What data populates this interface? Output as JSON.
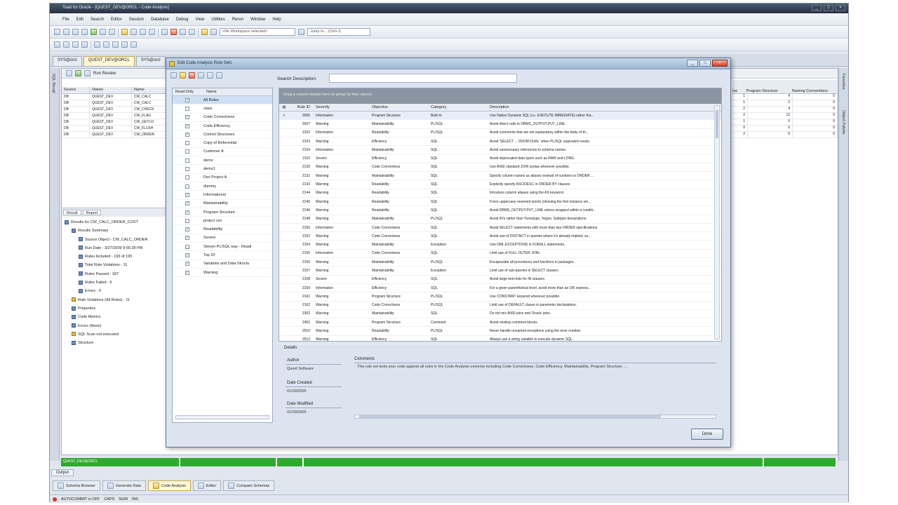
{
  "window": {
    "title": "Toad for Oracle - [QUEST_DEV@ORCL - Code Analysis]",
    "controls": [
      "_",
      "□",
      "×"
    ]
  },
  "menu": [
    "File",
    "Edit",
    "Search",
    "Editor",
    "Session",
    "Database",
    "Debug",
    "View",
    "Utilities",
    "Rerun",
    "Window",
    "Help"
  ],
  "toolbar": {
    "schema_combo": "<No Workspace selected>",
    "jump_combo": "Jump to... (Ctrl+J)"
  },
  "dock_tabs": [
    "SYS@orcl",
    "QUEST_DEV@ORCL",
    "SYS@orcl"
  ],
  "left_strip_label": "SQL Recall",
  "right_strip_labels": [
    "Favorites",
    "Object Palette"
  ],
  "workspace": {
    "run_review_label": "Run Review",
    "grid_headers": [
      "Source",
      "Owner",
      "Name"
    ],
    "grid_rows": [
      [
        "DB",
        "QUEST_DEV",
        "CW_CALC"
      ],
      [
        "DB",
        "QUEST_DEV",
        "CW_CALC"
      ],
      [
        "DB",
        "QUEST_DEV",
        "CW_CHECK"
      ],
      [
        "DB",
        "QUEST_DEV",
        "CW_FLAG"
      ],
      [
        "DB",
        "QUEST_DEV",
        "CW_GETLO"
      ],
      [
        "DB",
        "QUEST_DEV",
        "CW_FLUSH"
      ],
      [
        "DB",
        "QUEST_DEV",
        "CW_ORDER"
      ]
    ],
    "right_headers": [
      "Ive",
      "Program Structure",
      "Naming Conventions"
    ],
    "right_rows": [
      [
        "1",
        "4",
        "0"
      ],
      [
        "1",
        "2",
        "0"
      ],
      [
        "2",
        "4",
        "0"
      ],
      [
        "2",
        "12",
        "0"
      ],
      [
        "1",
        "0",
        "0"
      ],
      [
        "0",
        "0",
        "0"
      ],
      [
        "2",
        "0",
        "0"
      ]
    ],
    "lower_tabs": [
      "Result",
      "Report"
    ],
    "tree": [
      "Results for CW_CALC_ORDER_COST",
      "Results Summary",
      "Source Object - CW_CALC_ORDER",
      "Run Date - 3/27/2009 9:55:28 PM",
      "Rules Included - 193 of 195",
      "Total Rule Violations - 11",
      "Rules Passed - 187",
      "Rules Failed - 6",
      "Errors - 0",
      "Rule Violations (All Rules) - 11",
      "Properties",
      "Code Metrics",
      "Errors (None)",
      "SQL Scan not executed",
      "Structure"
    ],
    "bottom_row_status": "DB DUCHSS"
  },
  "status_strip": [
    "QUEST_DEV@ORCL",
    "",
    "",
    "",
    ""
  ],
  "output_label": "Output",
  "bottom_tabs": [
    "Schema Browser",
    "Generate Data",
    "Code Analysis",
    "Editor",
    "Compare Schemas"
  ],
  "statusbar": [
    "AUTOCOMMIT is OFF",
    "CAPS",
    "NUM",
    "INS"
  ],
  "dialog": {
    "title": "Edit Code Analysis Rule Sets",
    "search_label": "Search Description:",
    "left_headers": [
      "Read Only",
      "Name"
    ],
    "rule_sets": [
      {
        "name": "All Rules",
        "ro": true
      },
      {
        "name": "class",
        "ro": false
      },
      {
        "name": "Code Correctness",
        "ro": true
      },
      {
        "name": "Code Efficiency",
        "ro": true
      },
      {
        "name": "Control Structures",
        "ro": true
      },
      {
        "name": "Copy of Referential",
        "ro": false
      },
      {
        "name": "Customer A",
        "ro": false
      },
      {
        "name": "demo",
        "ro": false
      },
      {
        "name": "demo1",
        "ro": false
      },
      {
        "name": "Dev Project A",
        "ro": false
      },
      {
        "name": "dummy",
        "ro": false
      },
      {
        "name": "Informational",
        "ro": true
      },
      {
        "name": "Maintainability",
        "ro": true
      },
      {
        "name": "Program Structure",
        "ro": true
      },
      {
        "name": "project xxx",
        "ro": false
      },
      {
        "name": "Readability",
        "ro": true
      },
      {
        "name": "Severe",
        "ro": true
      },
      {
        "name": "Steven PL/SQL way - Readi",
        "ro": false
      },
      {
        "name": "Top 20",
        "ro": true
      },
      {
        "name": "Variables and Data Structu",
        "ro": true
      },
      {
        "name": "Warning",
        "ro": true
      }
    ],
    "group_hint": "Drag a column header here to group by that column",
    "grid_headers": [
      "Rule ID",
      "Severity",
      "Objective",
      "Category",
      "Description"
    ],
    "rules": [
      [
        "2006",
        "Information",
        "Program Structure",
        "Built-In",
        "Use Native Dynamic SQL (i.e. EXECUTE IMMEDIATE) rather tha..."
      ],
      [
        "2007",
        "Warning",
        "Maintainability",
        "PL/SQL",
        "Avoid direct calls to DBMS_OUTPUT.PUT_LINE."
      ],
      [
        "2102",
        "Information",
        "Readability",
        "PL/SQL",
        "Avoid comments that are not explanatory within the body of th..."
      ],
      [
        "2103",
        "Warning",
        "Efficiency",
        "SQL",
        "Avoid 'SELECT ... FROM DUAL' when PL/SQL equivalent exists."
      ],
      [
        "2104",
        "Information",
        "Maintainability",
        "SQL",
        "Avoid unnecessary references to schema names."
      ],
      [
        "2110",
        "Severe",
        "Efficiency",
        "SQL",
        "Avoid deprecated data types such as RAW and LONG."
      ],
      [
        "2130",
        "Warning",
        "Code Correctness",
        "SQL",
        "Use ANSI standard JOIN syntax wherever possible."
      ],
      [
        "2132",
        "Warning",
        "Maintainability",
        "SQL",
        "Specify column names as aliases instead of numbers in ORDER ..."
      ],
      [
        "2133",
        "Warning",
        "Readability",
        "SQL",
        "Explicitly specify ASC/DESC in ORDER BY clauses."
      ],
      [
        "2144",
        "Warning",
        "Readability",
        "SQL",
        "Introduce column aliases using the AS keyword."
      ],
      [
        "2145",
        "Warning",
        "Readability",
        "SQL",
        "Force uppercase reserved words (showing the first instance wri..."
      ],
      [
        "2146",
        "Warning",
        "Readability",
        "SQL",
        "Avoid DBMS_OUTPUT.PUT_LINE unless wrapped within a conditi..."
      ],
      [
        "2148",
        "Warning",
        "Maintainability",
        "PL/SQL",
        "Avoid IN's rather than %rowtype, %type, Subtype declarations."
      ],
      [
        "2150",
        "Information",
        "Code Correctness",
        "SQL",
        "Avoid SELECT statements with more than two ORDER specifications."
      ],
      [
        "2152",
        "Warning",
        "Code Correctness",
        "SQL",
        "Avoid use of DISTINCT in queries where it's already implied, su..."
      ],
      [
        "2154",
        "Warning",
        "Maintainability",
        "Exception",
        "Use DML EXCEPTIONS in FORALL statements."
      ],
      [
        "2155",
        "Information",
        "Code Correctness",
        "SQL",
        "Limit use of FULL OUTER JOIN."
      ],
      [
        "2156",
        "Warning",
        "Maintainability",
        "PL/SQL",
        "Encapsulate all procedures and functions in packages."
      ],
      [
        "2157",
        "Warning",
        "Maintainability",
        "Exception",
        "Limit use of sub-queries in SELECT clauses."
      ],
      [
        "2158",
        "Severe",
        "Efficiency",
        "SQL",
        "Avoid large item lists for IN clauses."
      ],
      [
        "2159",
        "Information",
        "Efficiency",
        "SQL",
        "For a given parenthetical level, avoid more than an OR express..."
      ],
      [
        "2161",
        "Warning",
        "Program Structure",
        "PL/SQL",
        "Use CONSTANT keyword wherever possible."
      ],
      [
        "2162",
        "Warning",
        "Code Correctness",
        "PL/SQL",
        "Limit use of DEFAULT clause in parameter declarations."
      ],
      [
        "2302",
        "Warning",
        "Maintainability",
        "SQL",
        "Do not mix ANSI joins and Oracle joins."
      ],
      [
        "2401",
        "Warning",
        "Program Structure",
        "Comment",
        "Avoid nesting comment blocks."
      ],
      [
        "2510",
        "Warning",
        "Readability",
        "PL/SQL",
        "Never handle unnamed exceptions using the error number."
      ],
      [
        "2512",
        "Warning",
        "Efficiency",
        "SQL",
        "Always use a string variable to execute dynamic SQL."
      ]
    ],
    "details_label": "Details",
    "author_label": "Author",
    "author_value": "Quest Software",
    "comments_label": "Comments",
    "comments_value": "This rule set tests your code against all rules in the Code Analysis universe including Code Correctness, Code Efficiency, Maintainability, Program Structure, ...",
    "date_created_label": "Date Created",
    "date_created_value": "01/09/2005",
    "date_modified_label": "Date Modified",
    "date_modified_value": "01/09/2005",
    "done_label": "Done"
  }
}
